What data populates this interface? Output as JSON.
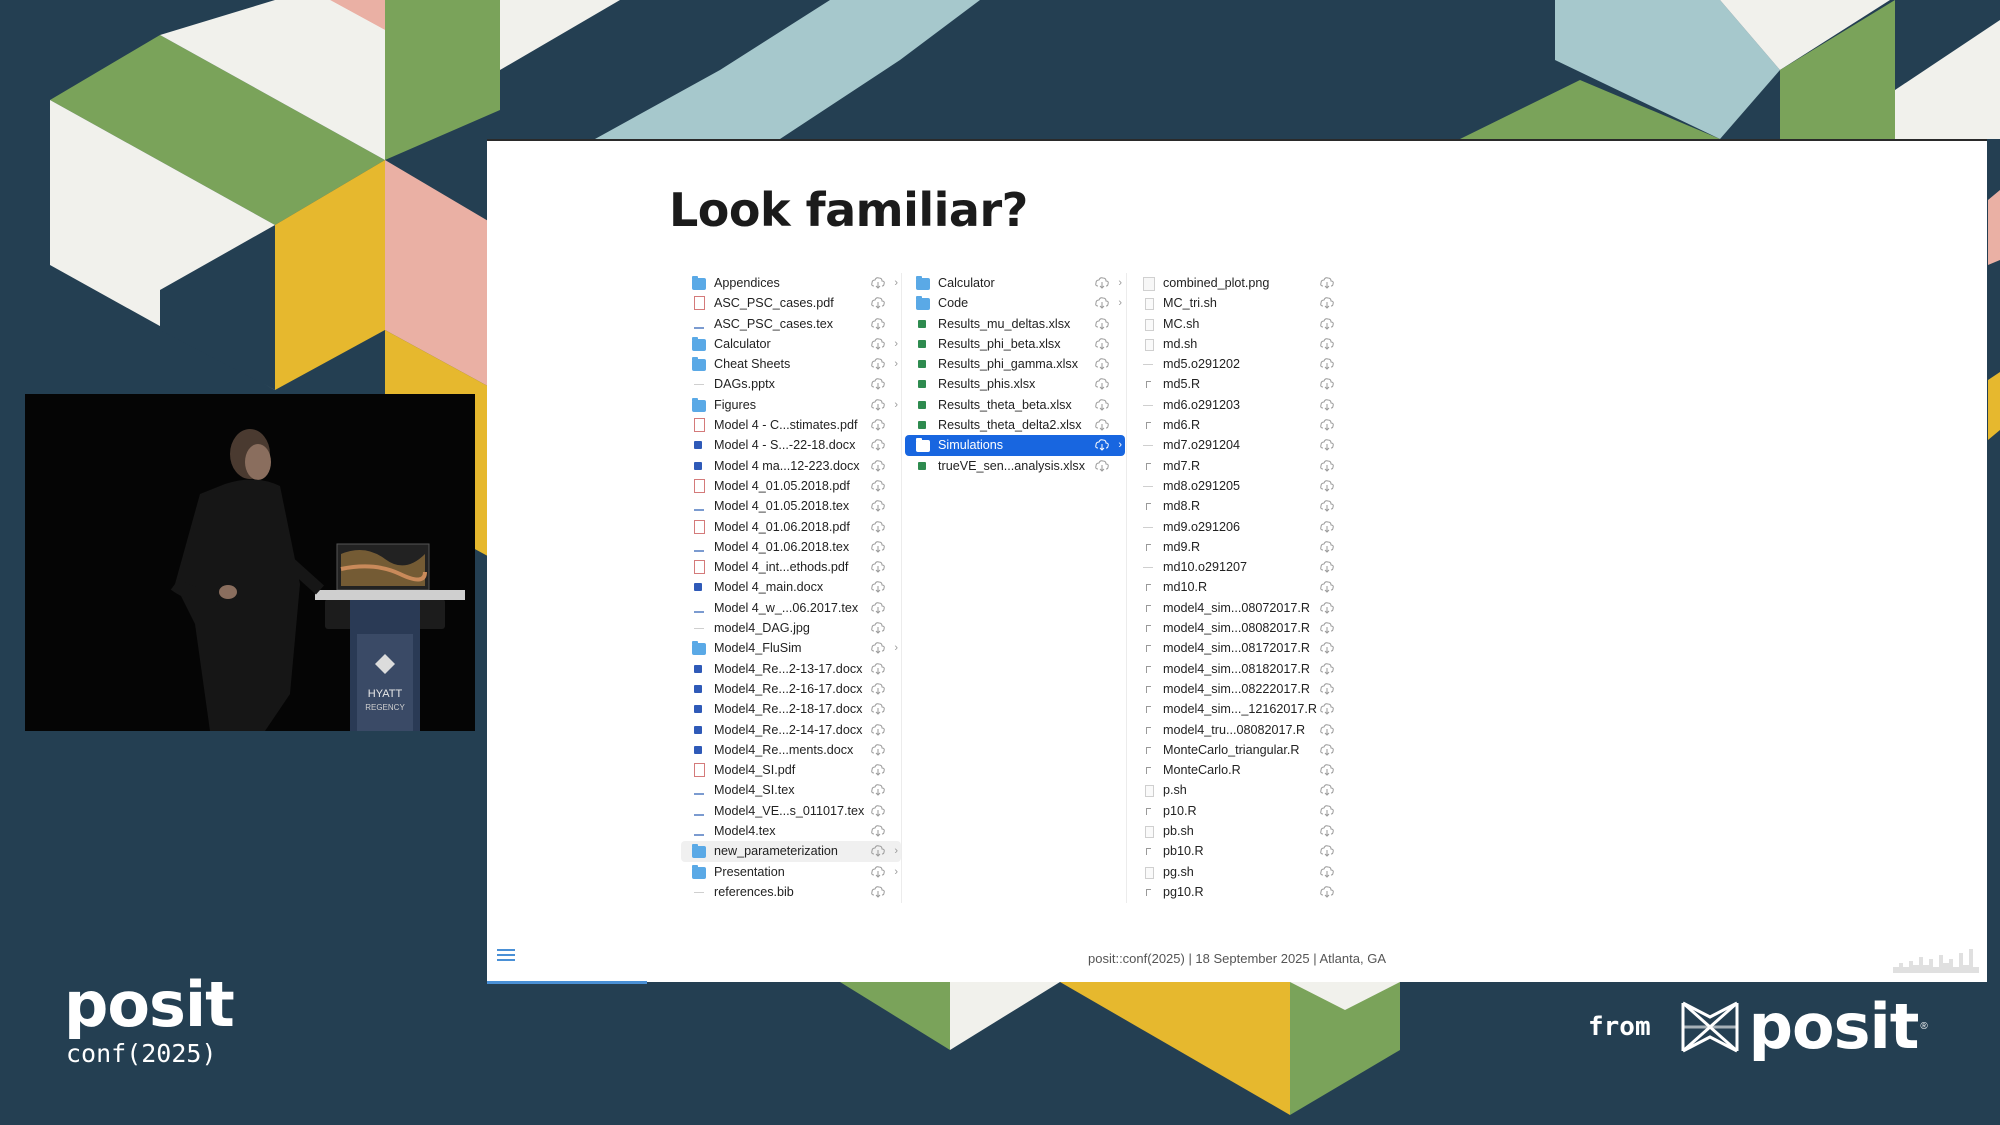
{
  "slide": {
    "title": "Look familiar?",
    "footer": "posit::conf(2025) | 18 September 2025 | Atlanta, GA"
  },
  "finder": {
    "columns": [
      [
        {
          "name": "Appendices",
          "icon": "folder-icon",
          "arrow": true
        },
        {
          "name": "ASC_PSC_cases.pdf",
          "icon": "pdf-icon"
        },
        {
          "name": "ASC_PSC_cases.tex",
          "icon": "tex-icon"
        },
        {
          "name": "Calculator",
          "icon": "folder-icon",
          "arrow": true
        },
        {
          "name": "Cheat Sheets",
          "icon": "folder-icon",
          "arrow": true
        },
        {
          "name": "DAGs.pptx",
          "icon": "blank-icon"
        },
        {
          "name": "Figures",
          "icon": "folder-icon",
          "arrow": true
        },
        {
          "name": "Model 4 - C...stimates.pdf",
          "icon": "pdf-icon"
        },
        {
          "name": "Model 4 - S...-22-18.docx",
          "icon": "word-icon"
        },
        {
          "name": "Model 4 ma...12-223.docx",
          "icon": "word-icon"
        },
        {
          "name": "Model 4_01.05.2018.pdf",
          "icon": "pdf-icon"
        },
        {
          "name": "Model 4_01.05.2018.tex",
          "icon": "tex-icon"
        },
        {
          "name": "Model 4_01.06.2018.pdf",
          "icon": "pdf-icon"
        },
        {
          "name": "Model 4_01.06.2018.tex",
          "icon": "tex-icon"
        },
        {
          "name": "Model 4_int...ethods.pdf",
          "icon": "pdf-icon"
        },
        {
          "name": "Model 4_main.docx",
          "icon": "word-icon"
        },
        {
          "name": "Model 4_w_...06.2017.tex",
          "icon": "tex-icon"
        },
        {
          "name": "model4_DAG.jpg",
          "icon": "blank-icon"
        },
        {
          "name": "Model4_FluSim",
          "icon": "folder-icon",
          "arrow": true
        },
        {
          "name": "Model4_Re...2-13-17.docx",
          "icon": "word-icon"
        },
        {
          "name": "Model4_Re...2-16-17.docx",
          "icon": "word-icon"
        },
        {
          "name": "Model4_Re...2-18-17.docx",
          "icon": "word-icon"
        },
        {
          "name": "Model4_Re...2-14-17.docx",
          "icon": "word-icon"
        },
        {
          "name": "Model4_Re...ments.docx",
          "icon": "word-icon"
        },
        {
          "name": "Model4_SI.pdf",
          "icon": "pdf-icon"
        },
        {
          "name": "Model4_SI.tex",
          "icon": "tex-icon"
        },
        {
          "name": "Model4_VE...s_011017.tex",
          "icon": "tex-icon"
        },
        {
          "name": "Model4.tex",
          "icon": "tex-icon"
        },
        {
          "name": "new_parameterization",
          "icon": "folder-icon",
          "arrow": true,
          "state": "highlighted"
        },
        {
          "name": "Presentation",
          "icon": "folder-icon",
          "arrow": true
        },
        {
          "name": "references.bib",
          "icon": "blank-icon"
        }
      ],
      [
        {
          "name": "Calculator",
          "icon": "folder-icon",
          "arrow": true
        },
        {
          "name": "Code",
          "icon": "folder-icon",
          "arrow": true
        },
        {
          "name": "Results_mu_deltas.xlsx",
          "icon": "excel-icon"
        },
        {
          "name": "Results_phi_beta.xlsx",
          "icon": "excel-icon"
        },
        {
          "name": "Results_phi_gamma.xlsx",
          "icon": "excel-icon"
        },
        {
          "name": "Results_phis.xlsx",
          "icon": "excel-icon"
        },
        {
          "name": "Results_theta_beta.xlsx",
          "icon": "excel-icon"
        },
        {
          "name": "Results_theta_delta2.xlsx",
          "icon": "excel-icon"
        },
        {
          "name": "Simulations",
          "icon": "folder-icon",
          "arrow": true,
          "state": "selected"
        },
        {
          "name": "trueVE_sen...analysis.xlsx",
          "icon": "excel-icon"
        }
      ],
      [
        {
          "name": "combined_plot.png",
          "icon": "image-icon"
        },
        {
          "name": "MC_tri.sh",
          "icon": "shell-icon"
        },
        {
          "name": "MC.sh",
          "icon": "shell-icon"
        },
        {
          "name": "md.sh",
          "icon": "shell-icon"
        },
        {
          "name": "md5.o291202",
          "icon": "blank-icon"
        },
        {
          "name": "md5.R",
          "icon": "r-icon"
        },
        {
          "name": "md6.o291203",
          "icon": "blank-icon"
        },
        {
          "name": "md6.R",
          "icon": "r-icon"
        },
        {
          "name": "md7.o291204",
          "icon": "blank-icon"
        },
        {
          "name": "md7.R",
          "icon": "r-icon"
        },
        {
          "name": "md8.o291205",
          "icon": "blank-icon"
        },
        {
          "name": "md8.R",
          "icon": "r-icon"
        },
        {
          "name": "md9.o291206",
          "icon": "blank-icon"
        },
        {
          "name": "md9.R",
          "icon": "r-icon"
        },
        {
          "name": "md10.o291207",
          "icon": "blank-icon"
        },
        {
          "name": "md10.R",
          "icon": "r-icon"
        },
        {
          "name": "model4_sim...08072017.R",
          "icon": "r-icon"
        },
        {
          "name": "model4_sim...08082017.R",
          "icon": "r-icon"
        },
        {
          "name": "model4_sim...08172017.R",
          "icon": "r-icon"
        },
        {
          "name": "model4_sim...08182017.R",
          "icon": "r-icon"
        },
        {
          "name": "model4_sim...08222017.R",
          "icon": "r-icon"
        },
        {
          "name": "model4_sim..._12162017.R",
          "icon": "r-icon"
        },
        {
          "name": "model4_tru...08082017.R",
          "icon": "r-icon"
        },
        {
          "name": "MonteCarlo_triangular.R",
          "icon": "r-icon"
        },
        {
          "name": "MonteCarlo.R",
          "icon": "r-icon"
        },
        {
          "name": "p.sh",
          "icon": "shell-icon"
        },
        {
          "name": "p10.R",
          "icon": "r-icon"
        },
        {
          "name": "pb.sh",
          "icon": "shell-icon"
        },
        {
          "name": "pb10.R",
          "icon": "r-icon"
        },
        {
          "name": "pg.sh",
          "icon": "shell-icon"
        },
        {
          "name": "pg10.R",
          "icon": "r-icon"
        }
      ]
    ]
  },
  "camera": {
    "podium_sign": [
      "HYATT",
      "REGENCY"
    ]
  },
  "branding": {
    "left_logo": {
      "word": "posit",
      "sub": "conf(2025)"
    },
    "right_logo": {
      "from": "from",
      "word": "posit",
      "tm": "®"
    }
  },
  "colors": {
    "background": "#243f52",
    "green": "#7aa35a",
    "yellow": "#e6b82e",
    "pink": "#eab0a4",
    "light_blue": "#a6c8cc",
    "cream": "#f1f1ec",
    "selection": "#1866e0",
    "folder": "#5aa9e6",
    "accent_blue": "#4a90d6"
  }
}
